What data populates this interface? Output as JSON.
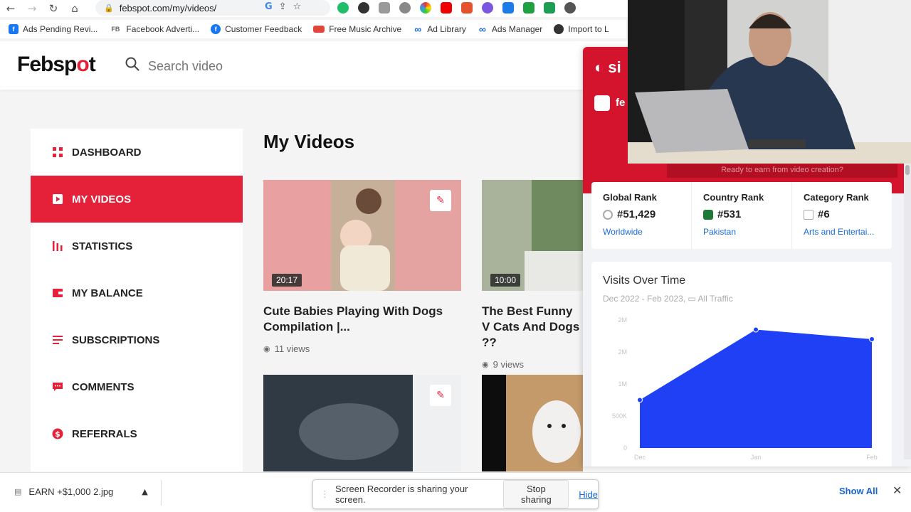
{
  "browser": {
    "url": "febspot.com/my/videos/",
    "bookmarks": [
      {
        "label": "Ads Pending Revi...",
        "icon": "facebook-icon",
        "color": "#1877f2"
      },
      {
        "label": "Facebook Adverti...",
        "icon": "fb-text-icon",
        "color": "#666666"
      },
      {
        "label": "Customer Feedback",
        "icon": "facebook-round-icon",
        "color": "#1877f2"
      },
      {
        "label": "Free Music Archive",
        "icon": "fma-icon",
        "color": "#e0453a"
      },
      {
        "label": "Ad Library",
        "icon": "meta-icon",
        "color": "#1a66d2"
      },
      {
        "label": "Ads Manager",
        "icon": "meta-icon",
        "color": "#1a66d2"
      },
      {
        "label": "Import to L",
        "icon": "globe-icon",
        "color": "#333333"
      }
    ]
  },
  "header": {
    "logo_main": "Febsp",
    "logo_accent": "o",
    "logo_end": "t",
    "search_placeholder": "Search video"
  },
  "sidebar": {
    "items": [
      {
        "label": "DASHBOARD",
        "icon": "grid-icon",
        "active": false
      },
      {
        "label": "MY VIDEOS",
        "icon": "video-icon",
        "active": true
      },
      {
        "label": "STATISTICS",
        "icon": "bar-chart-icon",
        "active": false
      },
      {
        "label": "MY BALANCE",
        "icon": "wallet-icon",
        "active": false
      },
      {
        "label": "SUBSCRIPTIONS",
        "icon": "list-icon",
        "active": false
      },
      {
        "label": "COMMENTS",
        "icon": "comment-icon",
        "active": false
      },
      {
        "label": "REFERRALS",
        "icon": "dollar-icon",
        "active": false
      }
    ]
  },
  "main": {
    "title": "My Videos",
    "videos": [
      {
        "title": "Cute Babies Playing With Dogs Compilation |...",
        "duration": "20:17",
        "views": "11 views"
      },
      {
        "title": "The Best Funny V Cats And Dogs ??",
        "duration": "10:00",
        "views": "9 views"
      }
    ]
  },
  "similarweb": {
    "logo": "si",
    "site_short": "fe",
    "cta": "Ready to earn from video creation?",
    "ranks": [
      {
        "label": "Global Rank",
        "value": "#51,429",
        "link": "Worldwide"
      },
      {
        "label": "Country Rank",
        "value": "#531",
        "link": "Pakistan"
      },
      {
        "label": "Category Rank",
        "value": "#6",
        "link": "Arts and Entertai..."
      }
    ],
    "visits_title": "Visits Over Time",
    "visits_range": "Dec 2022 - Feb 2023",
    "visits_filter": "All Traffic"
  },
  "chart_data": {
    "type": "area",
    "categories": [
      "Dec",
      "Jan",
      "Feb"
    ],
    "values": [
      750000,
      1850000,
      1700000
    ],
    "ylim": [
      0,
      2000000
    ],
    "ytick_labels": [
      "0",
      "500K",
      "1M",
      "2M",
      "2M"
    ],
    "color": "#1f40f5"
  },
  "downloads": {
    "file": "EARN +$1,000 2.jpg",
    "show_all": "Show All"
  },
  "screen_share": {
    "message": "Screen Recorder is sharing your screen.",
    "stop": "Stop sharing",
    "hide": "Hide"
  }
}
